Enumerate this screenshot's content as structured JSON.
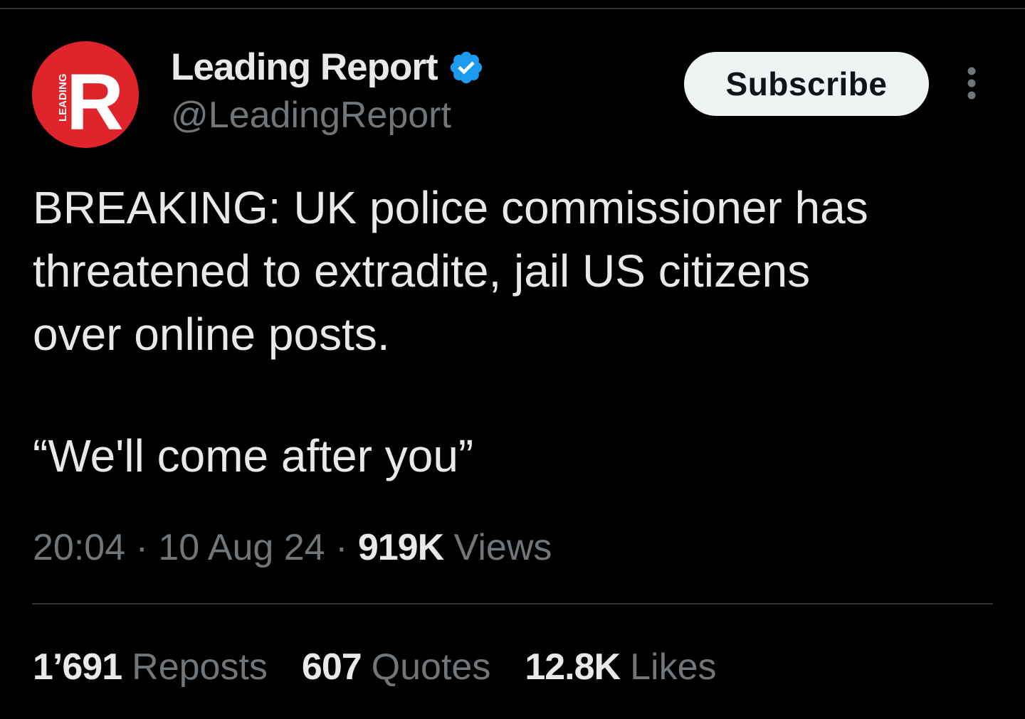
{
  "author": {
    "display_name": "Leading Report",
    "handle": "@LeadingReport",
    "verified": true,
    "avatar": {
      "letter": "R",
      "tag": "LEADING",
      "bg_color": "#e0242b"
    }
  },
  "actions": {
    "subscribe_label": "Subscribe",
    "more_icon": "more-vertical-icon"
  },
  "tweet": {
    "text_lines": [
      "BREAKING: UK police commissioner has",
      "threatened to extradite, jail US citizens",
      "over online posts."
    ],
    "quote": "“We'll come after you”"
  },
  "meta": {
    "time": "20:04",
    "separator": "·",
    "date": "10 Aug 24",
    "views_count": "919K",
    "views_label": "Views"
  },
  "stats": {
    "reposts_count": "1’691",
    "reposts_label": "Reposts",
    "quotes_count": "607",
    "quotes_label": "Quotes",
    "likes_count": "12.8K",
    "likes_label": "Likes"
  },
  "colors": {
    "background": "#000000",
    "text_primary": "#e7e9ea",
    "text_secondary": "#71767b",
    "verified_blue": "#1d9bf0",
    "divider": "#2f3336"
  }
}
